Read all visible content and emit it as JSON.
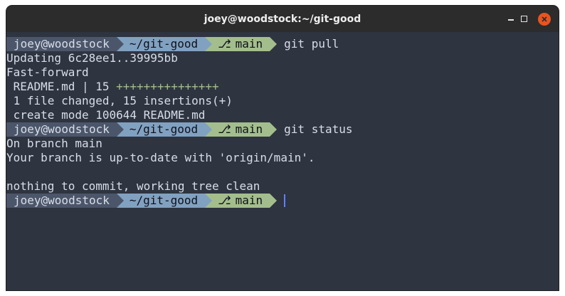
{
  "window": {
    "title": "joey@woodstock:~/git-good"
  },
  "prompt": {
    "user_host": "joey@woodstock",
    "dir": "~/git-good",
    "branch_icon": "⎇",
    "branch": "main"
  },
  "lines": [
    {
      "type": "prompt",
      "command": "git pull"
    },
    {
      "type": "output",
      "text": "Updating 6c28ee1..39995bb"
    },
    {
      "type": "output",
      "text": "Fast-forward"
    },
    {
      "type": "diffstat",
      "text": " README.md | 15 ",
      "plus": "+++++++++++++++"
    },
    {
      "type": "output",
      "text": " 1 file changed, 15 insertions(+)"
    },
    {
      "type": "output",
      "text": " create mode 100644 README.md"
    },
    {
      "type": "prompt",
      "command": "git status"
    },
    {
      "type": "output",
      "text": "On branch main"
    },
    {
      "type": "output",
      "text": "Your branch is up-to-date with 'origin/main'."
    },
    {
      "type": "output",
      "text": ""
    },
    {
      "type": "output",
      "text": "nothing to commit, working tree clean"
    },
    {
      "type": "prompt",
      "command": ""
    }
  ],
  "colors": {
    "background": "#2e3440",
    "titlebar": "#2c2c2c",
    "user_segment": "#4c566a",
    "dir_segment": "#81a1c1",
    "branch_segment": "#a3be8c",
    "close_button": "#e95420",
    "cursor": "#5e81ff"
  }
}
